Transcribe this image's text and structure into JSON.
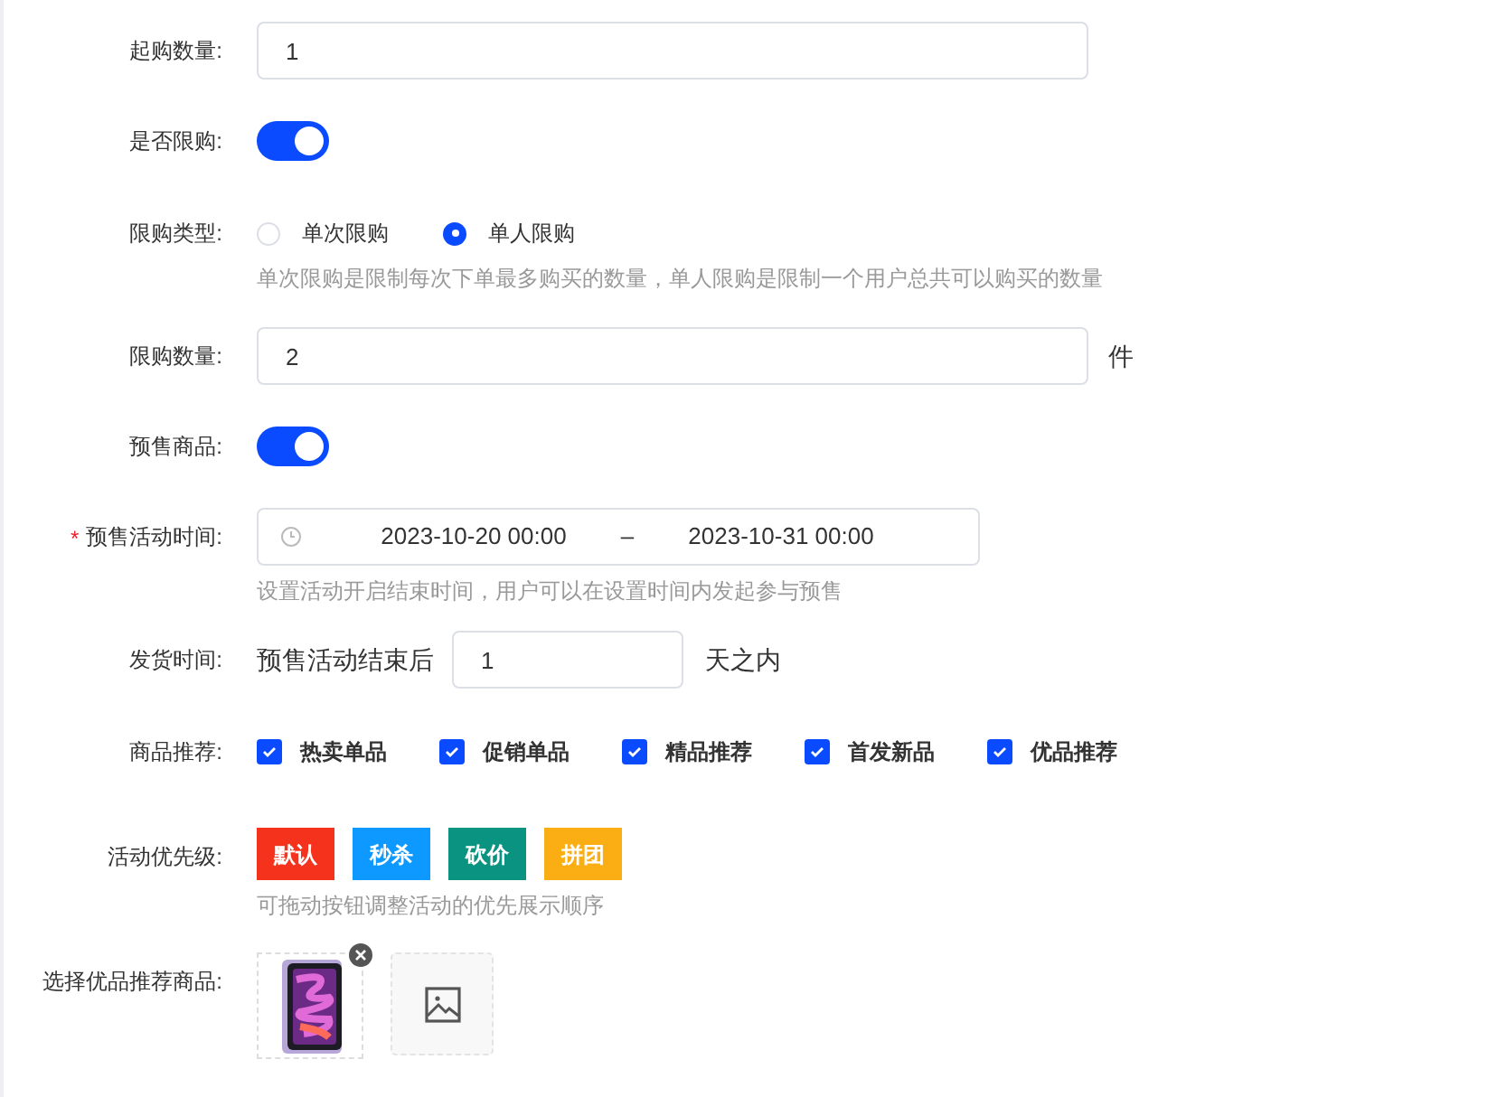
{
  "fields": [
    {
      "kind": "input",
      "label": "起购数量:",
      "value": "1"
    },
    {
      "kind": "switch",
      "label": "是否限购:",
      "on": true
    },
    {
      "kind": "radio",
      "label": "限购类型:",
      "options": [
        {
          "label": "单次限购",
          "selected": false
        },
        {
          "label": "单人限购",
          "selected": true
        }
      ],
      "help": "单次限购是限制每次下单最多购买的数量，单人限购是限制一个用户总共可以购买的数量"
    },
    {
      "kind": "input",
      "label": "限购数量:",
      "value": "2",
      "suffix": "件"
    },
    {
      "kind": "switch",
      "label": "预售商品:",
      "on": true
    },
    {
      "kind": "daterange",
      "label": "预售活动时间:",
      "required_mark": "*",
      "start": "2023-10-20 00:00",
      "separator": "–",
      "end": "2023-10-31 00:00",
      "help": "设置活动开启结束时间，用户可以在设置时间内发起参与预售"
    },
    {
      "kind": "inline_input",
      "label": "发货时间:",
      "prefix": "预售活动结束后",
      "value": "1",
      "suffix": "天之内"
    },
    {
      "kind": "checkbox",
      "label": "商品推荐:",
      "options": [
        {
          "label": "热卖单品",
          "checked": true
        },
        {
          "label": "促销单品",
          "checked": true
        },
        {
          "label": "精品推荐",
          "checked": true
        },
        {
          "label": "首发新品",
          "checked": true
        },
        {
          "label": "优品推荐",
          "checked": true
        }
      ]
    },
    {
      "kind": "tags",
      "label": "活动优先级:",
      "tags": [
        {
          "label": "默认",
          "color": "#f5331c"
        },
        {
          "label": "秒杀",
          "color": "#0d99ff"
        },
        {
          "label": "砍价",
          "color": "#0a9381"
        },
        {
          "label": "拼团",
          "color": "#fbae13"
        }
      ],
      "help": "可拖动按钮调整活动的优先展示顺序"
    },
    {
      "kind": "images",
      "label": "选择优品推荐商品:",
      "items": [
        {
          "kind": "picture"
        },
        {
          "kind": "empty"
        }
      ]
    }
  ]
}
